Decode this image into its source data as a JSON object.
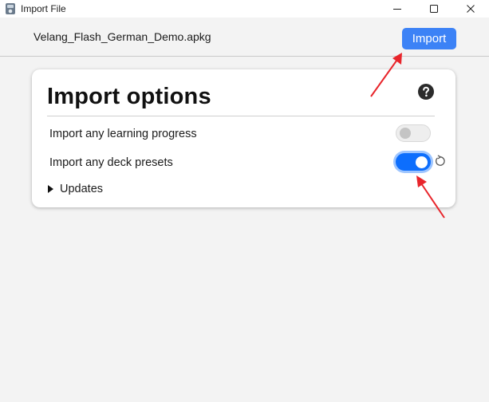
{
  "window": {
    "title": "Import File",
    "minimize_icon": "minimize-icon",
    "maximize_icon": "maximize-icon",
    "close_icon": "close-icon"
  },
  "header": {
    "file_name": "Velang_Flash_German_Demo.apkg",
    "import_label": "Import"
  },
  "card": {
    "title": "Import options",
    "help_icon": "question-circle-icon",
    "options": [
      {
        "label": "Import any learning progress",
        "enabled": false
      },
      {
        "label": "Import any deck presets",
        "enabled": true
      }
    ],
    "reset_icon": "reset-icon",
    "updates_label": "Updates"
  },
  "colors": {
    "accent": "#3c82f6",
    "toggle_on": "#0d6efd",
    "annotation_arrow": "#e8252b"
  }
}
